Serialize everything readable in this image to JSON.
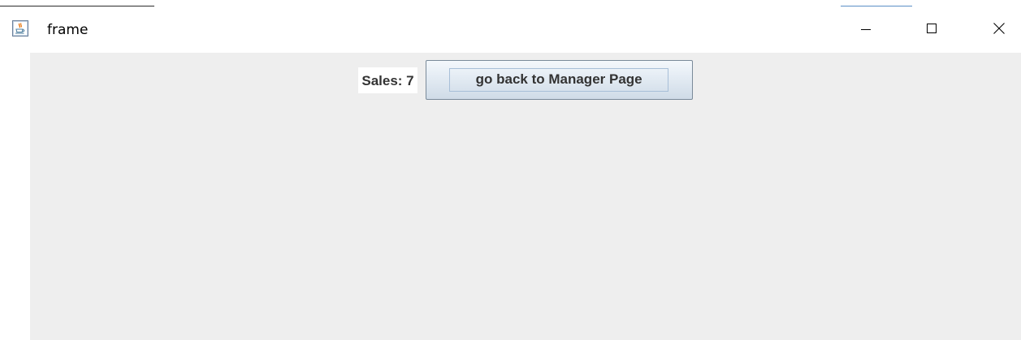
{
  "window": {
    "title": "frame",
    "icon": "java-coffee-cup-icon",
    "controls": {
      "minimize_icon": "minimize-icon",
      "maximize_icon": "maximize-icon",
      "close_icon": "close-icon"
    }
  },
  "panel": {
    "sales_label": "Sales: 7",
    "back_button_label": "go back to Manager Page"
  },
  "colors": {
    "content_background": "#eeeeee",
    "title_bar_background": "#ffffff",
    "button_border": "#7a8a99",
    "text": "#333333"
  }
}
